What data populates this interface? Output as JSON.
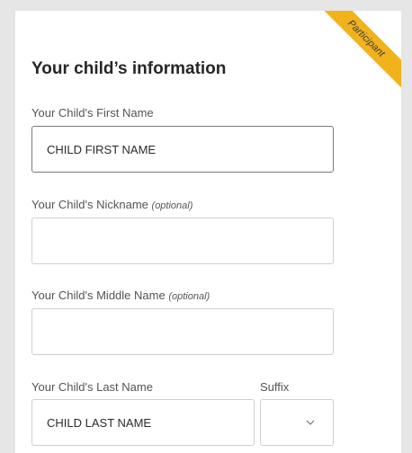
{
  "ribbon": {
    "label": "Participant"
  },
  "section": {
    "title": "Your child’s information"
  },
  "fields": {
    "first_name": {
      "label": "Your Child's First Name",
      "value": "CHILD FIRST NAME"
    },
    "nickname": {
      "label": "Your Child's Nickname",
      "optional": "(optional)",
      "value": ""
    },
    "middle_name": {
      "label": "Your Child's Middle Name",
      "optional": "(optional)",
      "value": ""
    },
    "last_name": {
      "label": "Your Child's Last Name",
      "value": "CHILD LAST NAME"
    },
    "suffix": {
      "label": "Suffix",
      "value": ""
    }
  },
  "colors": {
    "ribbon": "#f2b21c",
    "background": "#e6e6e6",
    "card": "#ffffff"
  },
  "icons": {
    "suffix_dropdown": "chevron-down-icon"
  }
}
